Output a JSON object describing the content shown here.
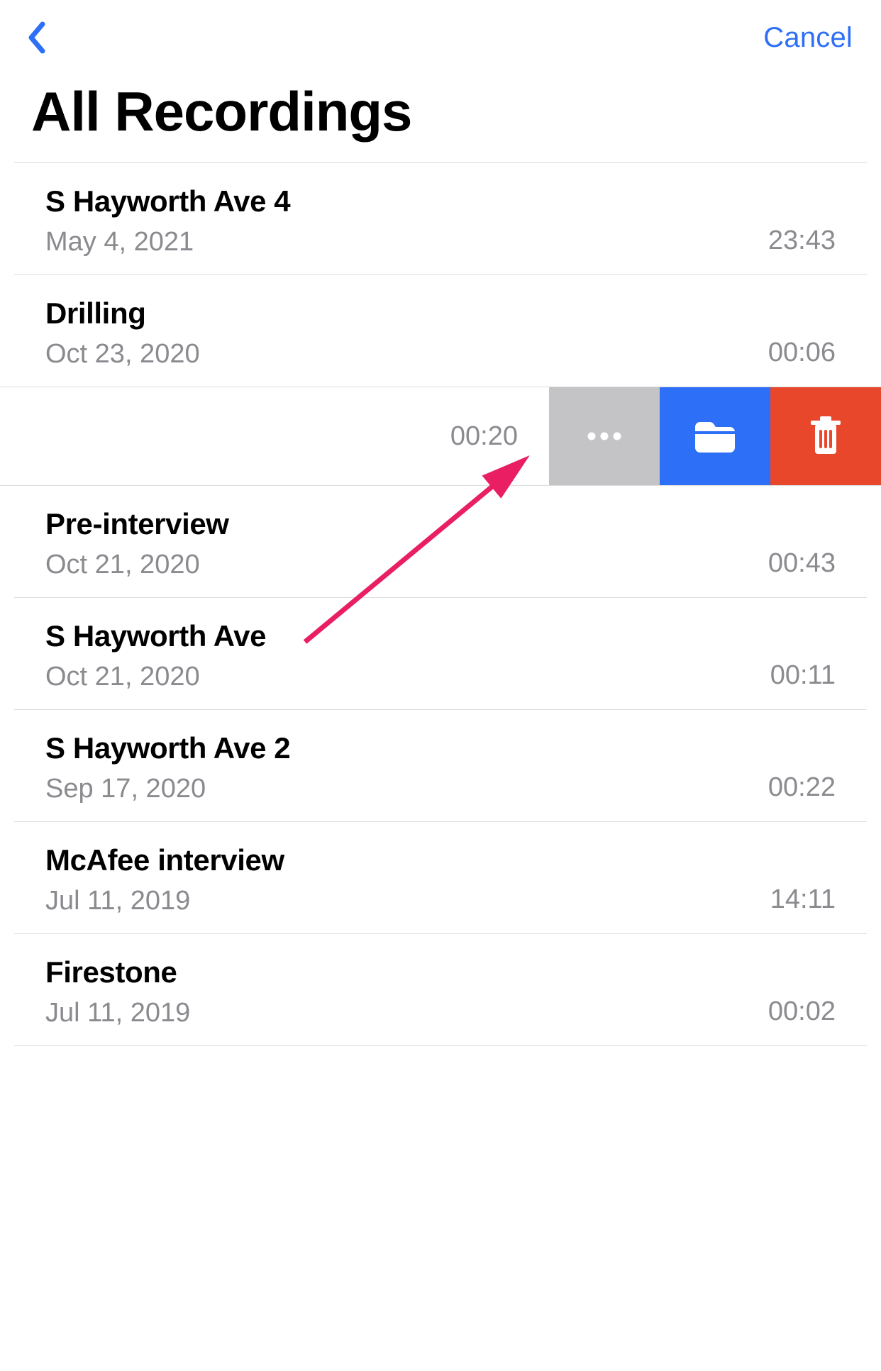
{
  "nav": {
    "cancel_label": "Cancel"
  },
  "page_title": "All Recordings",
  "swipe_row": {
    "duration": "00:20"
  },
  "recordings": [
    {
      "title": "S Hayworth Ave 4",
      "date": "May 4, 2021",
      "duration": "23:43"
    },
    {
      "title": "Drilling",
      "date": "Oct 23, 2020",
      "duration": "00:06"
    },
    {
      "title": "Pre-interview",
      "date": "Oct 21, 2020",
      "duration": "00:43"
    },
    {
      "title": "S Hayworth Ave",
      "date": "Oct 21, 2020",
      "duration": "00:11"
    },
    {
      "title": "S Hayworth Ave 2",
      "date": "Sep 17, 2020",
      "duration": "00:22"
    },
    {
      "title": "McAfee interview",
      "date": "Jul 11, 2019",
      "duration": "14:11"
    },
    {
      "title": "Firestone",
      "date": "Jul 11, 2019",
      "duration": "00:02"
    }
  ]
}
